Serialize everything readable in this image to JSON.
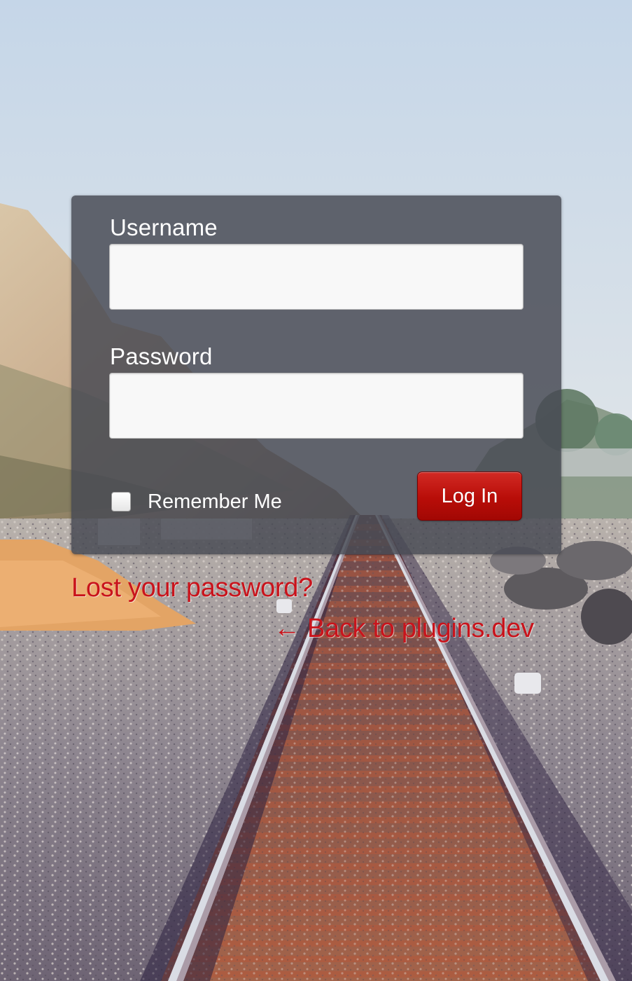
{
  "login_form": {
    "username_label": "Username",
    "username_value": "",
    "password_label": "Password",
    "password_value": "",
    "remember_me_label": "Remember Me",
    "remember_me_checked": false,
    "submit_label": "Log In"
  },
  "links": {
    "lost_password": "Lost your password?",
    "back_to_site": "← Back to plugins.dev"
  },
  "colors": {
    "accent_red": "#c9141c",
    "button_red": "#b80d08",
    "panel_bg": "#484a54"
  },
  "background": {
    "icon": "railroad-beach-photo"
  }
}
